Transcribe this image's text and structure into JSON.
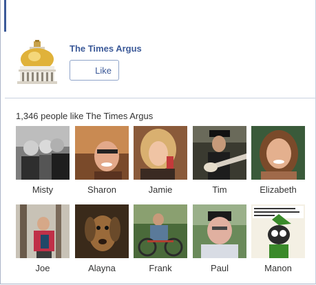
{
  "page": {
    "name": "The Times Argus",
    "like_label": "Like"
  },
  "fans": {
    "count_text": "1,346 people like The Times Argus",
    "people": [
      {
        "name": "Misty"
      },
      {
        "name": "Sharon"
      },
      {
        "name": "Jamie"
      },
      {
        "name": "Tim"
      },
      {
        "name": "Elizabeth"
      },
      {
        "name": "Joe"
      },
      {
        "name": "Alayna"
      },
      {
        "name": "Frank"
      },
      {
        "name": "Paul"
      },
      {
        "name": "Manon"
      }
    ]
  },
  "colors": {
    "link": "#3b5998",
    "border": "#aab4c8"
  }
}
